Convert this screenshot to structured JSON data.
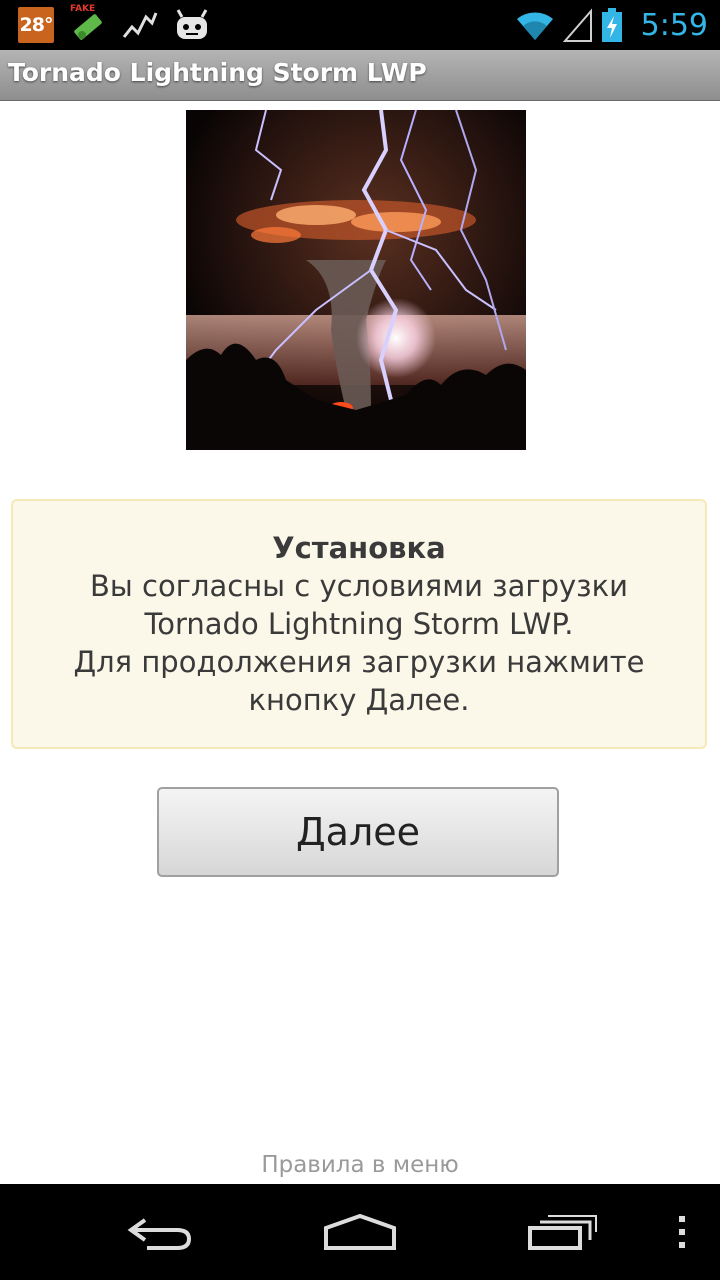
{
  "status_bar": {
    "temperature": "28°",
    "fake_label": "FAKE",
    "clock": "5:59",
    "clock_color": "#33b5e5",
    "icons": [
      "temperature-badge",
      "fake-gps-icon",
      "activity-graph-icon",
      "android-robot-icon",
      "wifi-icon",
      "signal-icon",
      "battery-charging-icon"
    ]
  },
  "app_bar": {
    "title": "Tornado Lightning Storm LWP"
  },
  "hero_image": {
    "description_icon": "tornado-lightning-image"
  },
  "info_box": {
    "title": "Установка",
    "lines": [
      "Вы согласны с условиями загрузки",
      "Tornado Lightning Storm LWP.",
      "Для продолжения загрузки нажмите",
      "кнопку Далее."
    ],
    "background": "#fbf8e9",
    "border": "#f6e9b6"
  },
  "next_button": {
    "label": "Далее"
  },
  "footer": {
    "rules_text": "Правила в меню"
  },
  "nav_bar": {
    "items": [
      "back-icon",
      "home-icon",
      "recent-apps-icon",
      "overflow-menu-icon"
    ]
  }
}
